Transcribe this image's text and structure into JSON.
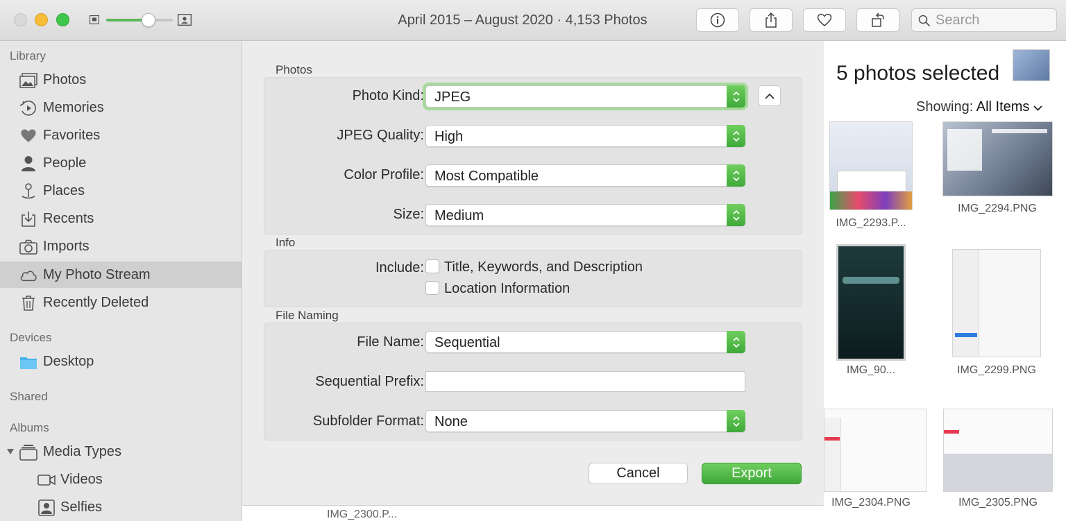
{
  "window": {
    "title": "April 2015 – August 2020 · 4,153 Photos",
    "search_placeholder": "Search"
  },
  "toolbar": {
    "zoom_level": 0.64,
    "buttons": [
      "info-icon",
      "share-icon",
      "heart-icon",
      "rotate-icon"
    ]
  },
  "sidebar": {
    "library_header": "Library",
    "library_items": [
      {
        "label": "Photos",
        "icon": "photos-icon"
      },
      {
        "label": "Memories",
        "icon": "memories-icon"
      },
      {
        "label": "Favorites",
        "icon": "heart-icon"
      },
      {
        "label": "People",
        "icon": "person-icon"
      },
      {
        "label": "Places",
        "icon": "pin-icon"
      },
      {
        "label": "Recents",
        "icon": "recents-icon"
      },
      {
        "label": "Imports",
        "icon": "camera-icon"
      },
      {
        "label": "My Photo Stream",
        "icon": "cloud-icon",
        "selected": true
      },
      {
        "label": "Recently Deleted",
        "icon": "trash-icon"
      }
    ],
    "devices_header": "Devices",
    "device_items": [
      {
        "label": "Desktop",
        "icon": "folder-icon"
      }
    ],
    "shared_header": "Shared",
    "albums_header": "Albums",
    "album_items": [
      {
        "label": "Media Types",
        "icon": "stack-icon"
      },
      {
        "label": "Videos",
        "icon": "video-icon"
      },
      {
        "label": "Selfies",
        "icon": "selfie-icon"
      }
    ]
  },
  "dialog": {
    "photos_group": "Photos",
    "photo_kind_label": "Photo Kind:",
    "photo_kind_value": "JPEG",
    "jpeg_quality_label": "JPEG Quality:",
    "jpeg_quality_value": "High",
    "color_profile_label": "Color Profile:",
    "color_profile_value": "Most Compatible",
    "size_label": "Size:",
    "size_value": "Medium",
    "info_group": "Info",
    "include_label": "Include:",
    "include_title_keywords": "Title, Keywords, and Description",
    "include_location": "Location Information",
    "file_naming_group": "File Naming",
    "file_name_label": "File Name:",
    "file_name_value": "Sequential",
    "sequential_prefix_label": "Sequential Prefix:",
    "sequential_prefix_value": "",
    "subfolder_format_label": "Subfolder Format:",
    "subfolder_format_value": "None",
    "cancel_label": "Cancel",
    "export_label": "Export"
  },
  "selection": {
    "title": "5 photos selected",
    "showing_label": "Showing:",
    "showing_value": "All Items"
  },
  "thumbnails": [
    {
      "caption": "IMG_2293.P..."
    },
    {
      "caption": "IMG_2294.PNG"
    },
    {
      "caption": "IMG_90..."
    },
    {
      "caption": "IMG_2299.PNG"
    },
    {
      "caption": "IMG_2304.PNG"
    },
    {
      "caption": "IMG_2305.PNG"
    }
  ],
  "background": {
    "partial_caption": "IMG_2300.P..."
  },
  "colors": {
    "accent_green": "#4cb944",
    "sidebar_bg": "#e6e6e6",
    "selected_row": "#cfcfcf"
  }
}
